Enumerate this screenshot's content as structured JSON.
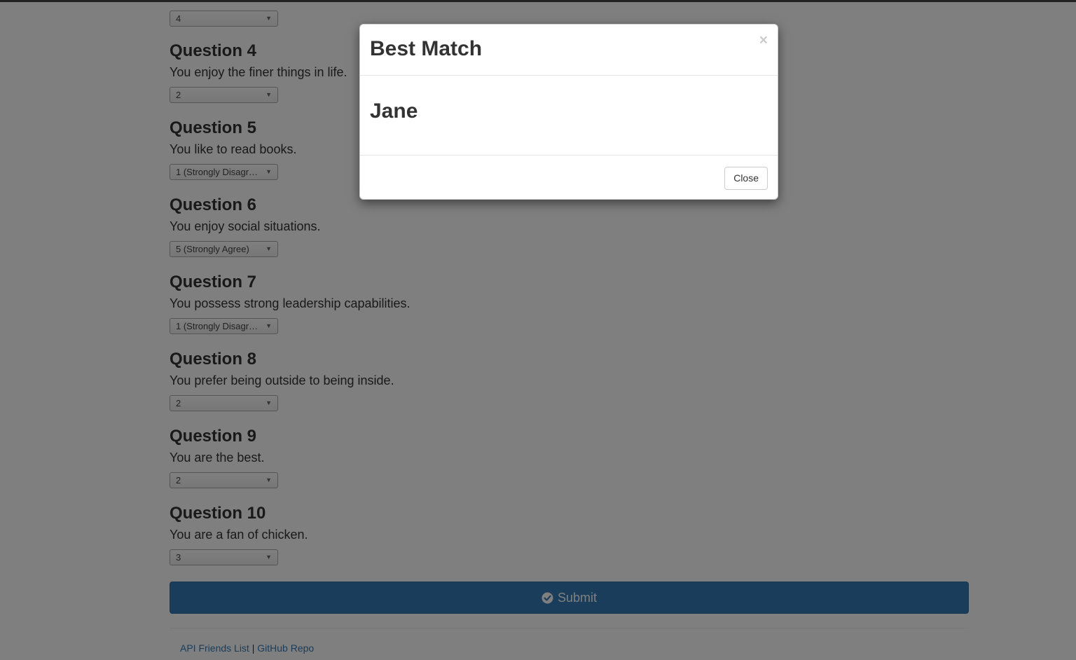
{
  "questions_prev": {
    "value": "4"
  },
  "questions": [
    {
      "title": "Question 4",
      "text": "You enjoy the finer things in life.",
      "value": "2"
    },
    {
      "title": "Question 5",
      "text": "You like to read books.",
      "value": "1 (Strongly Disagree)"
    },
    {
      "title": "Question 6",
      "text": "You enjoy social situations.",
      "value": "5 (Strongly Agree)"
    },
    {
      "title": "Question 7",
      "text": "You possess strong leadership capabilities.",
      "value": "1 (Strongly Disagree)"
    },
    {
      "title": "Question 8",
      "text": "You prefer being outside to being inside.",
      "value": "2"
    },
    {
      "title": "Question 9",
      "text": "You are the best.",
      "value": "2"
    },
    {
      "title": "Question 10",
      "text": "You are a fan of chicken.",
      "value": "3"
    }
  ],
  "submit": {
    "label": "Submit",
    "icon": "check-circle-icon"
  },
  "footer": {
    "link1": "API Friends List",
    "separator": " | ",
    "link2": "GitHub Repo"
  },
  "modal": {
    "title": "Best Match",
    "close_x": "×",
    "match_name": "Jane",
    "close_label": "Close"
  },
  "colors": {
    "primary": "#337ab7",
    "backdrop": "rgba(0,0,0,0.5)"
  }
}
